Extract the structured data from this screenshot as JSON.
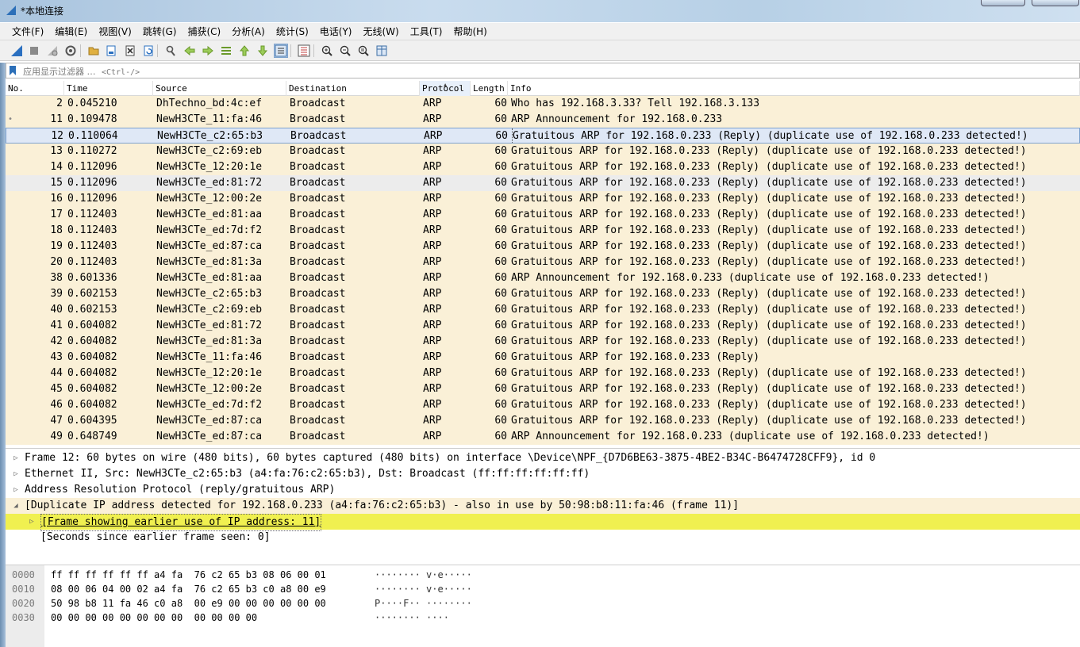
{
  "window": {
    "title": "*本地连接"
  },
  "menu": [
    "文件(F)",
    "编辑(E)",
    "视图(V)",
    "跳转(G)",
    "捕获(C)",
    "分析(A)",
    "统计(S)",
    "电话(Y)",
    "无线(W)",
    "工具(T)",
    "帮助(H)"
  ],
  "toolbar": {
    "icons": [
      "shark-fin-start-icon",
      "stop-icon",
      "restart-icon",
      "options-gear-icon",
      "open-folder-icon",
      "save-file-icon",
      "close-file-icon",
      "reload-icon",
      "find-icon",
      "go-back-icon",
      "go-forward-icon",
      "go-to-packet-icon",
      "first-packet-icon",
      "last-packet-icon",
      "autoscroll-icon",
      "colorize-icon",
      "zoom-in-icon",
      "zoom-out-icon",
      "zoom-normal-icon",
      "resize-columns-icon"
    ]
  },
  "filter": {
    "placeholder": "应用显示过滤器 … ",
    "shortcut": "<Ctrl-/>"
  },
  "packet_list": {
    "columns": [
      "No.",
      "Time",
      "Source",
      "Destination",
      "Protocol",
      "Length",
      "Info"
    ],
    "sorted_column": "Protocol",
    "rows": [
      {
        "no": "2",
        "time": "0.045210",
        "src": "DhTechno_bd:4c:ef",
        "dst": "Broadcast",
        "proto": "ARP",
        "len": "60",
        "info": "Who has 192.168.3.33? Tell 192.168.3.133",
        "mark": ""
      },
      {
        "no": "11",
        "time": "0.109478",
        "src": "NewH3CTe_11:fa:46",
        "dst": "Broadcast",
        "proto": "ARP",
        "len": "60",
        "info": "ARP Announcement for 192.168.0.233",
        "mark": "•"
      },
      {
        "no": "12",
        "time": "0.110064",
        "src": "NewH3CTe_c2:65:b3",
        "dst": "Broadcast",
        "proto": "ARP",
        "len": "60",
        "info": "Gratuitous ARP for 192.168.0.233 (Reply) (duplicate use of 192.168.0.233 detected!)",
        "mark": ""
      },
      {
        "no": "13",
        "time": "0.110272",
        "src": "NewH3CTe_c2:69:eb",
        "dst": "Broadcast",
        "proto": "ARP",
        "len": "60",
        "info": "Gratuitous ARP for 192.168.0.233 (Reply) (duplicate use of 192.168.0.233 detected!)",
        "mark": ""
      },
      {
        "no": "14",
        "time": "0.112096",
        "src": "NewH3CTe_12:20:1e",
        "dst": "Broadcast",
        "proto": "ARP",
        "len": "60",
        "info": "Gratuitous ARP for 192.168.0.233 (Reply) (duplicate use of 192.168.0.233 detected!)",
        "mark": ""
      },
      {
        "no": "15",
        "time": "0.112096",
        "src": "NewH3CTe_ed:81:72",
        "dst": "Broadcast",
        "proto": "ARP",
        "len": "60",
        "info": "Gratuitous ARP for 192.168.0.233 (Reply) (duplicate use of 192.168.0.233 detected!)",
        "mark": ""
      },
      {
        "no": "16",
        "time": "0.112096",
        "src": "NewH3CTe_12:00:2e",
        "dst": "Broadcast",
        "proto": "ARP",
        "len": "60",
        "info": "Gratuitous ARP for 192.168.0.233 (Reply) (duplicate use of 192.168.0.233 detected!)",
        "mark": ""
      },
      {
        "no": "17",
        "time": "0.112403",
        "src": "NewH3CTe_ed:81:aa",
        "dst": "Broadcast",
        "proto": "ARP",
        "len": "60",
        "info": "Gratuitous ARP for 192.168.0.233 (Reply) (duplicate use of 192.168.0.233 detected!)",
        "mark": ""
      },
      {
        "no": "18",
        "time": "0.112403",
        "src": "NewH3CTe_ed:7d:f2",
        "dst": "Broadcast",
        "proto": "ARP",
        "len": "60",
        "info": "Gratuitous ARP for 192.168.0.233 (Reply) (duplicate use of 192.168.0.233 detected!)",
        "mark": ""
      },
      {
        "no": "19",
        "time": "0.112403",
        "src": "NewH3CTe_ed:87:ca",
        "dst": "Broadcast",
        "proto": "ARP",
        "len": "60",
        "info": "Gratuitous ARP for 192.168.0.233 (Reply) (duplicate use of 192.168.0.233 detected!)",
        "mark": ""
      },
      {
        "no": "20",
        "time": "0.112403",
        "src": "NewH3CTe_ed:81:3a",
        "dst": "Broadcast",
        "proto": "ARP",
        "len": "60",
        "info": "Gratuitous ARP for 192.168.0.233 (Reply) (duplicate use of 192.168.0.233 detected!)",
        "mark": ""
      },
      {
        "no": "38",
        "time": "0.601336",
        "src": "NewH3CTe_ed:81:aa",
        "dst": "Broadcast",
        "proto": "ARP",
        "len": "60",
        "info": "ARP Announcement for 192.168.0.233 (duplicate use of 192.168.0.233 detected!)",
        "mark": ""
      },
      {
        "no": "39",
        "time": "0.602153",
        "src": "NewH3CTe_c2:65:b3",
        "dst": "Broadcast",
        "proto": "ARP",
        "len": "60",
        "info": "Gratuitous ARP for 192.168.0.233 (Reply) (duplicate use of 192.168.0.233 detected!)",
        "mark": ""
      },
      {
        "no": "40",
        "time": "0.602153",
        "src": "NewH3CTe_c2:69:eb",
        "dst": "Broadcast",
        "proto": "ARP",
        "len": "60",
        "info": "Gratuitous ARP for 192.168.0.233 (Reply) (duplicate use of 192.168.0.233 detected!)",
        "mark": ""
      },
      {
        "no": "41",
        "time": "0.604082",
        "src": "NewH3CTe_ed:81:72",
        "dst": "Broadcast",
        "proto": "ARP",
        "len": "60",
        "info": "Gratuitous ARP for 192.168.0.233 (Reply) (duplicate use of 192.168.0.233 detected!)",
        "mark": ""
      },
      {
        "no": "42",
        "time": "0.604082",
        "src": "NewH3CTe_ed:81:3a",
        "dst": "Broadcast",
        "proto": "ARP",
        "len": "60",
        "info": "Gratuitous ARP for 192.168.0.233 (Reply) (duplicate use of 192.168.0.233 detected!)",
        "mark": ""
      },
      {
        "no": "43",
        "time": "0.604082",
        "src": "NewH3CTe_11:fa:46",
        "dst": "Broadcast",
        "proto": "ARP",
        "len": "60",
        "info": "Gratuitous ARP for 192.168.0.233 (Reply)",
        "mark": ""
      },
      {
        "no": "44",
        "time": "0.604082",
        "src": "NewH3CTe_12:20:1e",
        "dst": "Broadcast",
        "proto": "ARP",
        "len": "60",
        "info": "Gratuitous ARP for 192.168.0.233 (Reply) (duplicate use of 192.168.0.233 detected!)",
        "mark": ""
      },
      {
        "no": "45",
        "time": "0.604082",
        "src": "NewH3CTe_12:00:2e",
        "dst": "Broadcast",
        "proto": "ARP",
        "len": "60",
        "info": "Gratuitous ARP for 192.168.0.233 (Reply) (duplicate use of 192.168.0.233 detected!)",
        "mark": ""
      },
      {
        "no": "46",
        "time": "0.604082",
        "src": "NewH3CTe_ed:7d:f2",
        "dst": "Broadcast",
        "proto": "ARP",
        "len": "60",
        "info": "Gratuitous ARP for 192.168.0.233 (Reply) (duplicate use of 192.168.0.233 detected!)",
        "mark": ""
      },
      {
        "no": "47",
        "time": "0.604395",
        "src": "NewH3CTe_ed:87:ca",
        "dst": "Broadcast",
        "proto": "ARP",
        "len": "60",
        "info": "Gratuitous ARP for 192.168.0.233 (Reply) (duplicate use of 192.168.0.233 detected!)",
        "mark": ""
      },
      {
        "no": "49",
        "time": "0.648749",
        "src": "NewH3CTe_ed:87:ca",
        "dst": "Broadcast",
        "proto": "ARP",
        "len": "60",
        "info": "ARP Announcement for 192.168.0.233 (duplicate use of 192.168.0.233 detected!)",
        "mark": ""
      }
    ],
    "selected_no": "12",
    "hovered_no": "15"
  },
  "details": [
    {
      "text": "Frame 12: 60 bytes on wire (480 bits), 60 bytes captured (480 bits) on interface \\Device\\NPF_{D7D6BE63-3875-4BE2-B34C-B6474728CFF9}, id 0",
      "expander": "▷",
      "level": 0,
      "style": ""
    },
    {
      "text": "Ethernet II, Src: NewH3CTe_c2:65:b3 (a4:fa:76:c2:65:b3), Dst: Broadcast (ff:ff:ff:ff:ff:ff)",
      "expander": "▷",
      "level": 0,
      "style": ""
    },
    {
      "text": "Address Resolution Protocol (reply/gratuitous ARP)",
      "expander": "▷",
      "level": 0,
      "style": ""
    },
    {
      "text": "[Duplicate IP address detected for 192.168.0.233 (a4:fa:76:c2:65:b3) - also in use by 50:98:b8:11:fa:46 (frame 11)]",
      "expander": "◢",
      "level": 0,
      "style": "expert"
    },
    {
      "text": "[Frame showing earlier use of IP address: 11]",
      "expander": "▷",
      "level": 1,
      "style": "hl"
    },
    {
      "text": "[Seconds since earlier frame seen: 0]",
      "expander": "",
      "level": 1,
      "style": ""
    }
  ],
  "bytes": [
    {
      "offset": "0000",
      "hex": "ff ff ff ff ff ff a4 fa  76 c2 65 b3 08 06 00 01",
      "ascii": "········ v·e·····"
    },
    {
      "offset": "0010",
      "hex": "08 00 06 04 00 02 a4 fa  76 c2 65 b3 c0 a8 00 e9",
      "ascii": "········ v·e·····"
    },
    {
      "offset": "0020",
      "hex": "50 98 b8 11 fa 46 c0 a8  00 e9 00 00 00 00 00 00",
      "ascii": "P····F·· ········"
    },
    {
      "offset": "0030",
      "hex": "00 00 00 00 00 00 00 00  00 00 00 00",
      "ascii": "········ ····"
    }
  ],
  "colors": {
    "arp_row": "#faf0d7",
    "selected_row": "#dfe8f6",
    "highlight": "#f0f050"
  }
}
